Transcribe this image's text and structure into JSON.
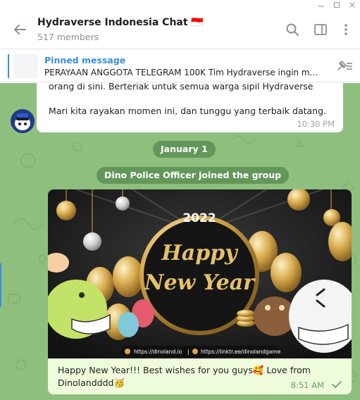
{
  "header": {
    "title": "Hydraverse Indonesia Chat 🇮🇩",
    "members": "517 members"
  },
  "pinned": {
    "label": "Pinned message",
    "text": "PERAYAAN ANGGOTA TELEGRAM 100K  Tim Hydraverse ingin me..."
  },
  "messages": {
    "top": {
      "line1": "orang di sini. Berteriak untuk semua warga sipil Hydraverse",
      "line2": "Mari kita rayakan momen ini, dan tunggu yang terbaik datang.",
      "time": "10:30 PM"
    },
    "date_divider": "January 1",
    "join_notice": "Dino Police Officer joined the group",
    "media": {
      "image_year": "2022",
      "image_line1": "Happy",
      "image_line2": "New Year",
      "image_link1": "https://dinoland.io",
      "image_sep": "|",
      "image_link2": "https://linktr.ee/dinolandgame",
      "caption": "Happy New Year!!! Best wishes for you guys🥰 Love from Dinolandddd🥳",
      "time": "8:51 AM"
    }
  },
  "colors": {
    "accent": "#3a8fd8",
    "chat_bg": "#8fbf7f",
    "outgoing_bubble": "#eefcdb",
    "read_check": "#67a65b"
  },
  "icons": {
    "back": "arrow-left-icon",
    "search": "search-icon",
    "sidebar": "sidebar-toggle-icon",
    "more": "more-vertical-icon",
    "unpin": "pin-list-icon",
    "read": "check-icon"
  }
}
